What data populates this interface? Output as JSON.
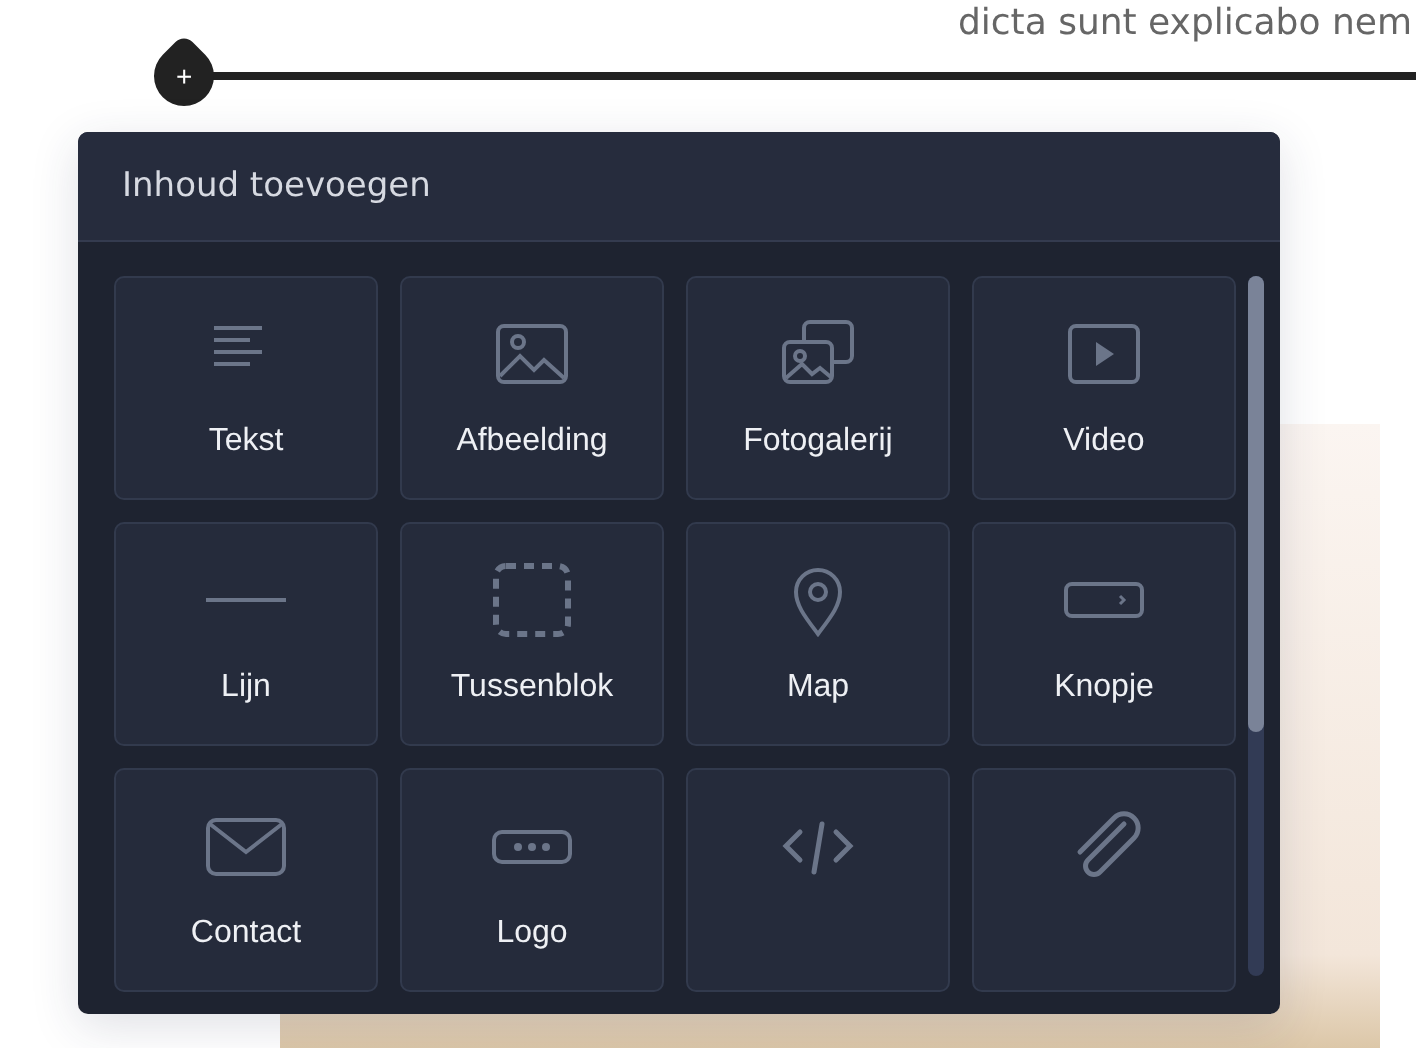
{
  "page_text": "dicta sunt explicabo nem",
  "add_button": {
    "label": "+"
  },
  "panel": {
    "title": "Inhoud toevoegen",
    "items": [
      {
        "label": "Tekst",
        "kind": "text"
      },
      {
        "label": "Afbeelding",
        "kind": "image"
      },
      {
        "label": "Fotogalerij",
        "kind": "gallery"
      },
      {
        "label": "Video",
        "kind": "video"
      },
      {
        "label": "Lijn",
        "kind": "line"
      },
      {
        "label": "Tussenblok",
        "kind": "spacer"
      },
      {
        "label": "Map",
        "kind": "map"
      },
      {
        "label": "Knopje",
        "kind": "button"
      },
      {
        "label": "Contact",
        "kind": "contact"
      },
      {
        "label": "Logo",
        "kind": "logo"
      },
      {
        "kind": "code"
      },
      {
        "kind": "attachment"
      }
    ]
  }
}
